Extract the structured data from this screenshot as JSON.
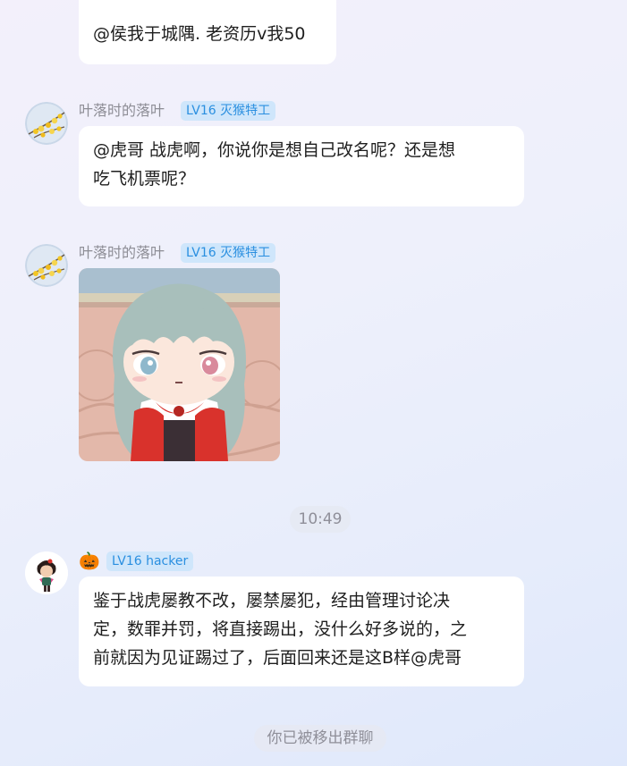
{
  "messages": [
    {
      "text": "@侯我于城隅. 老资历v我50"
    },
    {
      "sender": "叶落时的落叶",
      "badge": "LV16 灭猴特工",
      "text_lines": [
        "@虎哥 战虎啊，你说你是想自己改名呢？还是想",
        "吃飞机票呢？"
      ]
    },
    {
      "sender": "叶落时的落叶",
      "badge": "LV16 灭猴特工",
      "image": "anime-girl-sticker"
    },
    {
      "time": "10:49"
    },
    {
      "sender_icon": "🎃",
      "badge": "LV16 hacker",
      "text_lines": [
        "鉴于战虎屡教不改，屡禁屡犯，经由管理讨论决",
        "定，数罪并罚，将直接踢出，没什么好多说的，之",
        "前就因为见证踢过了，后面回来还是这B样@虎哥"
      ]
    }
  ],
  "system_notice": "你已被移出群聊",
  "colors": {
    "badge_bg": "#cfe6fb",
    "badge_text": "#2a8fe0",
    "bubble_bg": "#ffffff",
    "nickname": "#8d8d95"
  }
}
